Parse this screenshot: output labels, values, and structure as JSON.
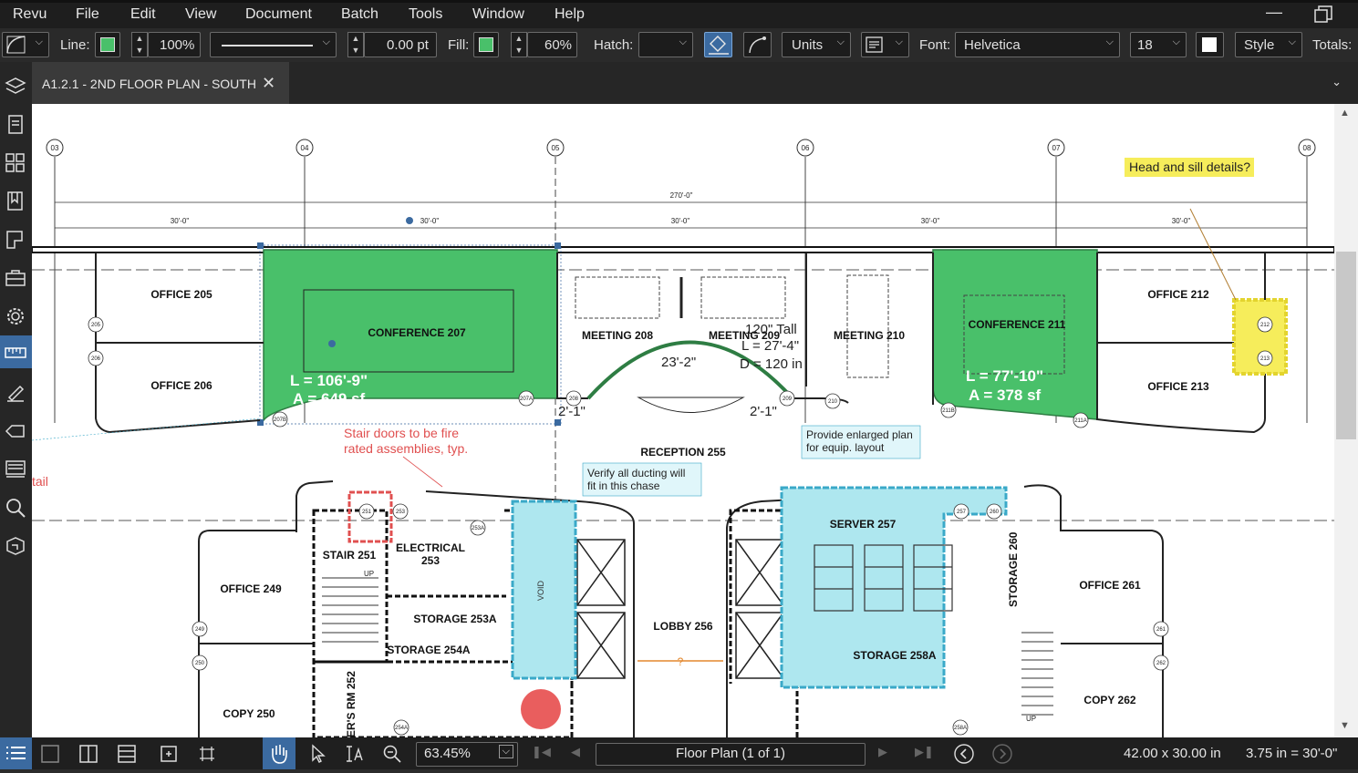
{
  "menu": {
    "items": [
      "Revu",
      "File",
      "Edit",
      "View",
      "Document",
      "Batch",
      "Tools",
      "Window",
      "Help"
    ]
  },
  "toolbar": {
    "line_label": "Line:",
    "line_opacity": "100%",
    "thickness": "0.00 pt",
    "fill_label": "Fill:",
    "fill_opacity": "60%",
    "hatch_label": "Hatch:",
    "units": "Units",
    "font_label": "Font:",
    "font": "Helvetica",
    "font_size": "18",
    "style": "Style",
    "totals_label": "Totals:",
    "line_color": "#49c06a",
    "fill_color": "#49c06a"
  },
  "tab": {
    "title": "A1.2.1 - 2ND FLOOR PLAN - SOUTH"
  },
  "sidebar": {
    "icons": [
      "layers-icon",
      "document-icon",
      "thumbnails-icon",
      "bookmarks-icon",
      "sheets-icon",
      "toolbox-icon",
      "settings-icon",
      "measure-icon",
      "markups-icon",
      "tag-icon",
      "stack-icon",
      "search-icon",
      "studio-icon"
    ]
  },
  "plan": {
    "grid_labels": [
      "03",
      "04",
      "05",
      "06",
      "07",
      "08"
    ],
    "overall_dim": "270'-0\"",
    "bay_dims": [
      "30'-0\"",
      "30'-0\"",
      "30'-0\"",
      "30'-0\"",
      "30'-0\""
    ],
    "rooms": {
      "office205": "OFFICE  205",
      "office206": "OFFICE  206",
      "conf207": "CONFERENCE  207",
      "meeting208": "MEETING  208",
      "meeting209": "MEETING  209",
      "meeting210": "MEETING  210",
      "conf211": "CONFERENCE  211",
      "office212": "OFFICE  212",
      "office213": "OFFICE  213",
      "reception": "RECEPTION  255",
      "stair251": "STAIR 251",
      "electrical": "ELECTRICAL",
      "electrical_num": "253",
      "storage253a": "STORAGE 253A",
      "storage254a": "STORAGE 254A",
      "office249": "OFFICE  249",
      "copy250": "COPY  250",
      "rm252": "ER'S RM 252",
      "void": "VOID",
      "lobby": "LOBBY  256",
      "server": "SERVER  257",
      "storage258a": "STORAGE 258A",
      "storage260": "STORAGE 260",
      "office261": "OFFICE  261",
      "copy262": "COPY  262",
      "up": "UP"
    },
    "measures": {
      "m1_l": "L = 106'-9\"",
      "m1_a": "A = 649 sf",
      "m2_l": "L = 77'-10\"",
      "m2_a": "A = 378 sf",
      "arc_len": "23'-2\"",
      "tall1": "120\" Tall",
      "tall2": "L = 27'-4\"",
      "tall3": "D = 120 in",
      "dim_left": "2'-1\"",
      "dim_right": "2'-1\"",
      "question": "?"
    },
    "door_tags": [
      "205",
      "206",
      "207B",
      "207A",
      "208",
      "209",
      "210",
      "211B",
      "211A",
      "212",
      "213",
      "251",
      "253",
      "253A",
      "257",
      "260",
      "249",
      "250",
      "261",
      "262",
      "254A",
      "258A"
    ],
    "notes": {
      "head_sill": "Head and sill details?",
      "stair_doors_1": "Stair doors to be fire",
      "stair_doors_2": "rated assemblies, typ.",
      "ducting_1": "Verify all ducting will",
      "ducting_2": "fit in this chase",
      "enlarged_1": "Provide enlarged plan",
      "enlarged_2": "for equip. layout",
      "detail_frag": "tail"
    }
  },
  "status": {
    "zoom": "63.45%",
    "page": "Floor Plan (1 of 1)",
    "size": "42.00 x 30.00 in",
    "scale": "3.75 in = 30'-0\""
  }
}
